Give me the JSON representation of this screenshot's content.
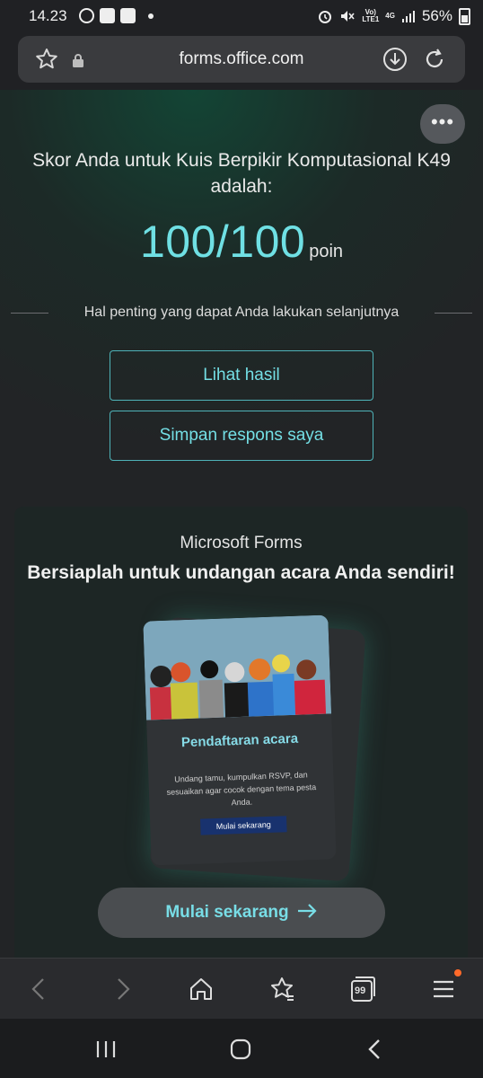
{
  "status_bar": {
    "time": "14.23",
    "network": "4G",
    "battery": "56%"
  },
  "browser": {
    "url": "forms.office.com",
    "icons": [
      "star-icon",
      "lock-icon",
      "download-icon",
      "reload-icon"
    ]
  },
  "page": {
    "more_label": "•••",
    "score_title": "Skor Anda untuk Kuis Berpikir Komputasional K49 adalah:",
    "score_value": "100/100",
    "score_unit": "poin",
    "next_steps_label": "Hal penting yang dapat Anda lakukan selanjutnya",
    "view_results_label": "Lihat hasil",
    "save_response_label": "Simpan respons saya"
  },
  "promo": {
    "brand": "Microsoft Forms",
    "headline": "Bersiaplah untuk undangan acara Anda sendiri!",
    "card_title": "Pendaftaran acara",
    "card_text": "Undang tamu, kumpulkan RSVP, dan sesuaikan agar cocok dengan tema pesta Anda.",
    "card_button": "Mulai sekarang",
    "start_label": "Mulai sekarang"
  },
  "bottom_bar": {
    "items": [
      "back-icon",
      "forward-icon",
      "home-icon",
      "bookmarks-icon",
      "tabs-icon",
      "menu-icon"
    ],
    "tabs_count": "99"
  },
  "colors": {
    "accent": "#6fe0e4",
    "badge": "#ff6a2a"
  }
}
